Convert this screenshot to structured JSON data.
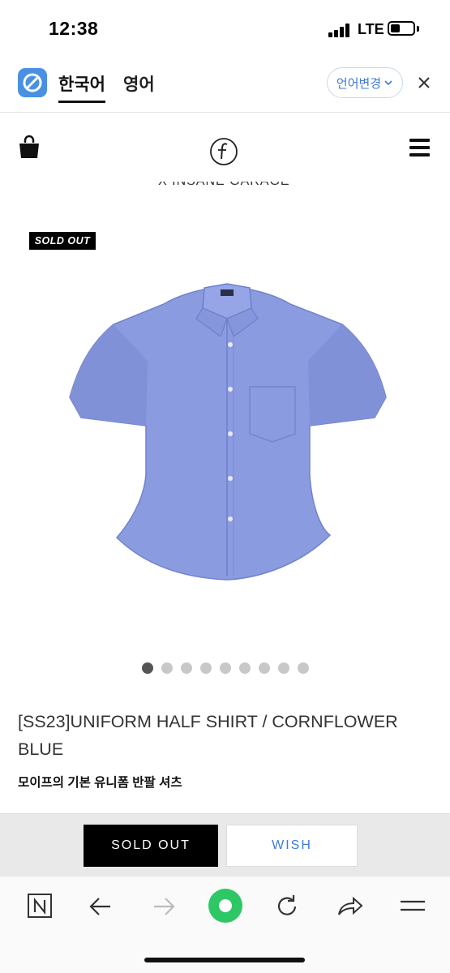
{
  "status_bar": {
    "time": "12:38",
    "network": "LTE"
  },
  "translate_bar": {
    "lang_active": "한국어",
    "lang_other": "영어",
    "change_label": "언어변경"
  },
  "site": {
    "cut_text": "X INSANE GARAGE"
  },
  "product": {
    "badge": "SOLD OUT",
    "image_count": 9,
    "active_image": 1,
    "title": "[SS23]UNIFORM HALF SHIRT / CORNFLOWER BLUE",
    "subtitle": "모이프의 기본 유니폼 반팔 셔츠"
  },
  "actions": {
    "soldout_label": "SOLD OUT",
    "wish_label": "WISH"
  },
  "colors": {
    "accent_blue": "#3d7bd9",
    "shirt": "#8a9be0",
    "browser_green": "#2ec766"
  }
}
